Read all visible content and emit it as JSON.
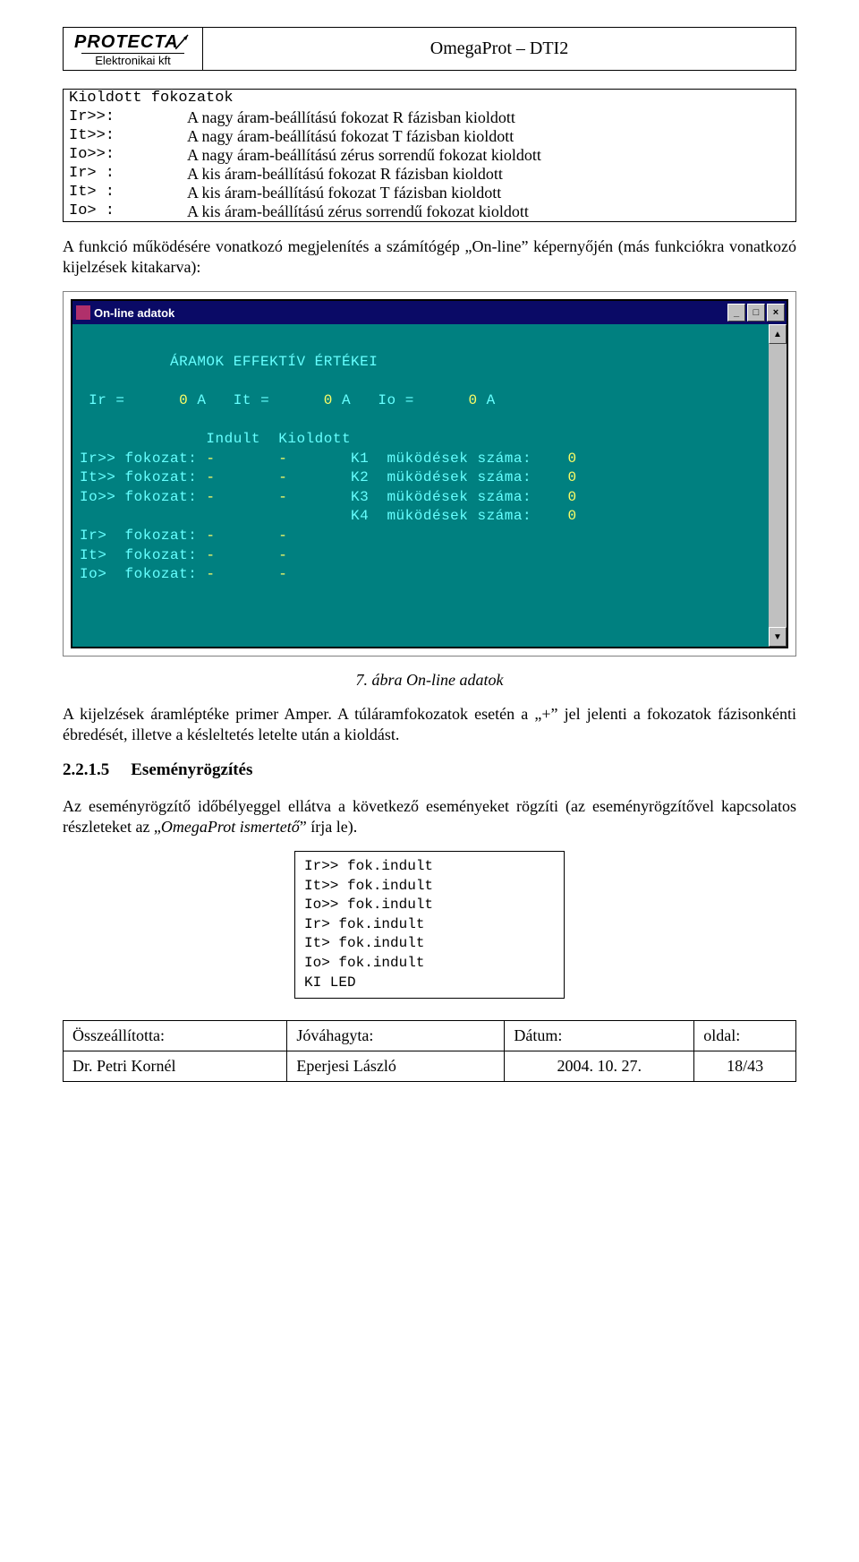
{
  "brand": {
    "name": "PROTECTA",
    "sub": "Elektronikai kft"
  },
  "header_title": "OmegaProt – DTI2",
  "def": {
    "head": "Kioldott fokozatok",
    "rows": [
      {
        "label": "Ir>>:",
        "desc": "A nagy áram-beállítású fokozat R fázisban kioldott"
      },
      {
        "label": "It>>:",
        "desc": "A nagy áram-beállítású fokozat T fázisban kioldott"
      },
      {
        "label": "Io>>:",
        "desc": "A nagy áram-beállítású zérus sorrendű fokozat kioldott"
      },
      {
        "label": "Ir> :",
        "desc": "A kis áram-beállítású fokozat R fázisban kioldott"
      },
      {
        "label": "It> :",
        "desc": "A kis áram-beállítású fokozat T fázisban kioldott"
      },
      {
        "label": "Io> :",
        "desc": "A kis áram-beállítású zérus sorrendű fokozat kioldott"
      }
    ]
  },
  "para1": "A funkció működésére vonatkozó megjelenítés a számítógép „On-line” képernyőjén (más funkciókra vonatkozó kijelzések kitakarva):",
  "win": {
    "title": "On-line adatok",
    "btn_min": "_",
    "btn_max": "□",
    "btn_close": "×",
    "sb_up": "▲",
    "sb_down": "▼",
    "term": {
      "heading": "ÁRAMOK EFFEKTÍV ÉRTÉKEI",
      "ir_label": "Ir =",
      "ir_val": "0",
      "ir_unit": "A",
      "it_label": "It =",
      "it_val": "0",
      "it_unit": "A",
      "io_label": "Io =",
      "io_val": "0",
      "io_unit": "A",
      "col_ind": "Indult",
      "col_kio": "Kioldott",
      "rows": [
        {
          "lbl": "Ir>> fokozat:",
          "ind": "-",
          "kio": "-",
          "k": "K1",
          "mk": "müködések száma:",
          "n": "0"
        },
        {
          "lbl": "It>> fokozat:",
          "ind": "-",
          "kio": "-",
          "k": "K2",
          "mk": "müködések száma:",
          "n": "0"
        },
        {
          "lbl": "Io>> fokozat:",
          "ind": "-",
          "kio": "-",
          "k": "K3",
          "mk": "müködések száma:",
          "n": "0"
        },
        {
          "lbl": "",
          "ind": "",
          "kio": "",
          "k": "K4",
          "mk": "müködések száma:",
          "n": "0"
        },
        {
          "lbl": "Ir>  fokozat:",
          "ind": "-",
          "kio": "-",
          "k": "",
          "mk": "",
          "n": ""
        },
        {
          "lbl": "It>  fokozat:",
          "ind": "-",
          "kio": "-",
          "k": "",
          "mk": "",
          "n": ""
        },
        {
          "lbl": "Io>  fokozat:",
          "ind": "-",
          "kio": "-",
          "k": "",
          "mk": "",
          "n": ""
        }
      ]
    }
  },
  "fig_caption": "7. ábra On-line adatok",
  "para2": "A kijelzések áramléptéke primer Amper. A túláramfokozatok esetén a „+” jel jelenti a fokozatok fázisonkénti ébredését, illetve a késleltetés letelte után a kioldást.",
  "section": {
    "num": "2.2.1.5",
    "title": "Eseményrögzítés"
  },
  "para3_a": "Az eseményrögzítő időbélyeggel ellátva a következő eseményeket rögzíti (az eseményrögzítővel kapcsolatos részleteket az „",
  "para3_i": "OmegaProt ismertető",
  "para3_b": "” írja le).",
  "events": [
    "Ir>> fok.indult",
    "It>> fok.indult",
    "Io>> fok.indult",
    "Ir> fok.indult",
    "It> fok.indult",
    "Io> fok.indult",
    "KI LED"
  ],
  "footer": {
    "h1": "Összeállította:",
    "h2": "Jóváhagyta:",
    "h3": "Dátum:",
    "h4": "oldal:",
    "v1": "Dr. Petri Kornél",
    "v2": "Eperjesi László",
    "v3": "2004. 10. 27.",
    "v4": "18/43"
  }
}
